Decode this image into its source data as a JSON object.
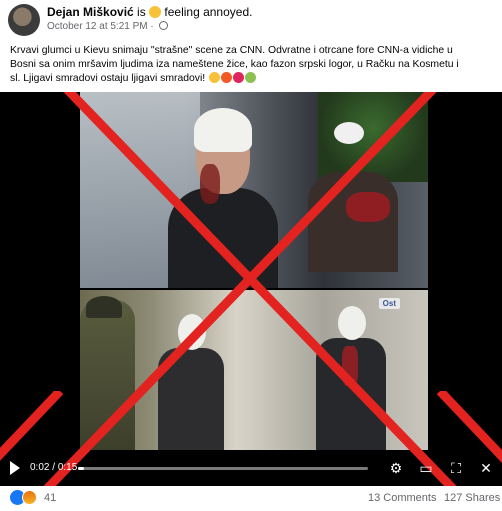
{
  "post": {
    "author": "Dejan Mišković",
    "is_text": " is ",
    "feeling": "feeling annoyed.",
    "timestamp": "October 12 at 5:21 PM",
    "separator": "·",
    "body_line1": "Krvavi glumci u Kievu snimaju \"strašne\" scene za CNN. Odvratne i otrcane fore CNN-a vidiche u",
    "body_line2": "Bosni sa onim mršavim ljudima iza nameštene žice, kao fazon srpski logor, u Račku na Kosmetu i",
    "body_line3": "sl. Ljigavi smradovi ostaju ljigavi smradovi!"
  },
  "video": {
    "current_time": "0:02",
    "time_separator": "/",
    "duration": "0:15",
    "progress_fraction": 0.02,
    "channel_badge": "Ost"
  },
  "footer": {
    "reaction_count": "41",
    "comments": "13 Comments",
    "shares": "127 Shares"
  },
  "colors": {
    "cross": "#e3231f",
    "link_blue": "#1877f2",
    "meta_gray": "#65676b"
  },
  "icons": [
    "globe-icon",
    "play-icon",
    "settings-icon",
    "speaker-icon",
    "fullscreen-icon",
    "volume-icon",
    "like-icon",
    "angry-icon",
    "annoyed-emoji",
    "crying-emoji",
    "angry-face-emoji",
    "nauseated-emoji"
  ]
}
